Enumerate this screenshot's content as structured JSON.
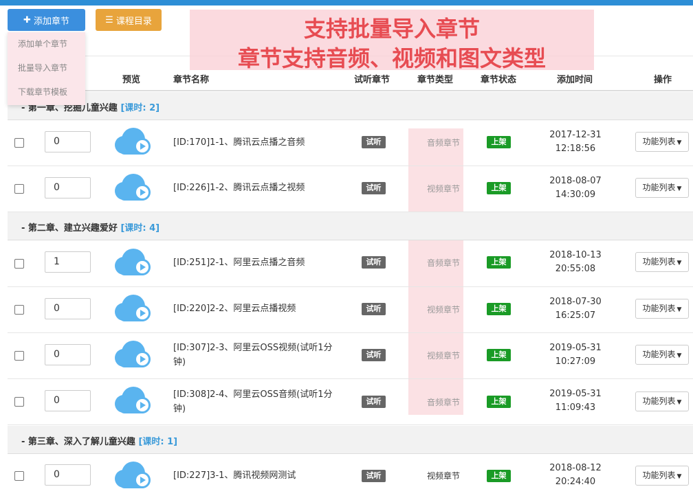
{
  "toolbar": {
    "add_label": "添加章节",
    "add_icon": "plus-icon",
    "catalog_label": "课程目录",
    "catalog_icon": "list-icon"
  },
  "dropdown": {
    "items": [
      "添加单个章节",
      "批量导入章节",
      "下载章节模板"
    ]
  },
  "banner": {
    "line1": "支持批量导入章节",
    "line2": "章节支持音频、视频和图文类型"
  },
  "table": {
    "headers": {
      "preview": "预览",
      "name": "章节名称",
      "trial": "试听章节",
      "type": "章节类型",
      "status": "章节状态",
      "time": "添加时间",
      "ops": "操作"
    },
    "groups": [
      {
        "title": "第一章、挖掘儿童兴趣",
        "hours": "[课时: 2]"
      },
      {
        "title": "第二章、建立兴趣爱好",
        "hours": "[课时: 4]"
      },
      {
        "title": "第三章、深入了解儿童兴趣",
        "hours": "[课时: 1]"
      }
    ],
    "rows": [
      {
        "order": "0",
        "name": "[ID:170]1-1、腾讯云点播之音频",
        "trial": "试听",
        "type": "音频章节",
        "status": "上架",
        "date": "2017-12-31",
        "clock": "12:18:56",
        "ops": "功能列表"
      },
      {
        "order": "0",
        "name": "[ID:226]1-2、腾讯云点播之视频",
        "trial": "试听",
        "type": "视频章节",
        "status": "上架",
        "date": "2018-08-07",
        "clock": "14:30:09",
        "ops": "功能列表"
      },
      {
        "order": "1",
        "name": "[ID:251]2-1、阿里云点播之音频",
        "trial": "试听",
        "type": "音频章节",
        "status": "上架",
        "date": "2018-10-13",
        "clock": "20:55:08",
        "ops": "功能列表"
      },
      {
        "order": "0",
        "name": "[ID:220]2-2、阿里云点播视频",
        "trial": "试听",
        "type": "视频章节",
        "status": "上架",
        "date": "2018-07-30",
        "clock": "16:25:07",
        "ops": "功能列表"
      },
      {
        "order": "0",
        "name": "[ID:307]2-3、阿里云OSS视频(试听1分钟)",
        "trial": "试听",
        "type": "视频章节",
        "status": "上架",
        "date": "2019-05-31",
        "clock": "10:27:09",
        "ops": "功能列表"
      },
      {
        "order": "0",
        "name": "[ID:308]2-4、阿里云OSS音频(试听1分钟)",
        "trial": "试听",
        "type": "音频章节",
        "status": "上架",
        "date": "2019-05-31",
        "clock": "11:09:43",
        "ops": "功能列表"
      },
      {
        "order": "0",
        "name": "[ID:227]3-1、腾讯视频网测试",
        "trial": "试听",
        "type": "视频章节",
        "status": "上架",
        "date": "2018-08-12",
        "clock": "20:24:40",
        "ops": "功能列表"
      }
    ]
  },
  "colors": {
    "primary": "#3b8fde",
    "catalog": "#e8a43c",
    "status_green": "#1a9b26",
    "trial_gray": "#666666",
    "banner_text": "#e74c52",
    "highlight": "#fbe1e4",
    "group_hours": "#3a9ad9"
  },
  "icons": {
    "preview": "cloud-play-icon",
    "ops_caret": "caret-down-icon"
  }
}
